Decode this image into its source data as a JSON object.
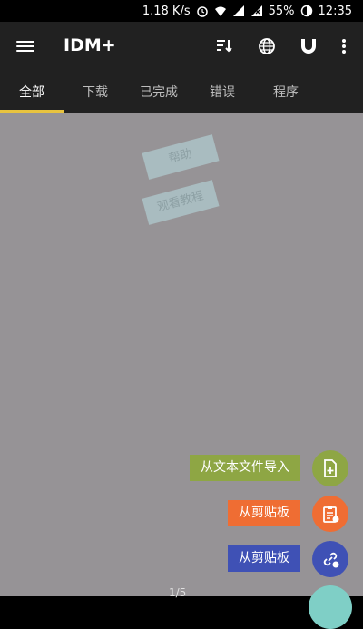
{
  "status": {
    "speed": "1.18 K/s",
    "battery": "55%",
    "time": "12:35"
  },
  "toolbar": {
    "title": "IDM+",
    "icons": [
      "sort-icon",
      "globe-icon",
      "magnet-icon",
      "more-vert-icon"
    ]
  },
  "tabs": [
    {
      "label": "全部",
      "active": true
    },
    {
      "label": "下载",
      "active": false
    },
    {
      "label": "已完成",
      "active": false
    },
    {
      "label": "错误",
      "active": false
    },
    {
      "label": "程序",
      "active": false
    }
  ],
  "hints": {
    "help": "帮助",
    "tutorial": "观看教程"
  },
  "fab_menu": [
    {
      "label": "从文本文件导入",
      "color": "#8ea644",
      "icon": "file-add-icon"
    },
    {
      "label": "从剪贴板",
      "color": "#ef6d33",
      "icon": "clipboard-icon"
    },
    {
      "label": "从剪贴板",
      "color": "#3f51b5",
      "icon": "link-add-icon"
    }
  ],
  "page_indicator": "1/5",
  "colors": {
    "toolbar": "#212121",
    "accent": "#e8c33e",
    "overlay": "#969396"
  }
}
